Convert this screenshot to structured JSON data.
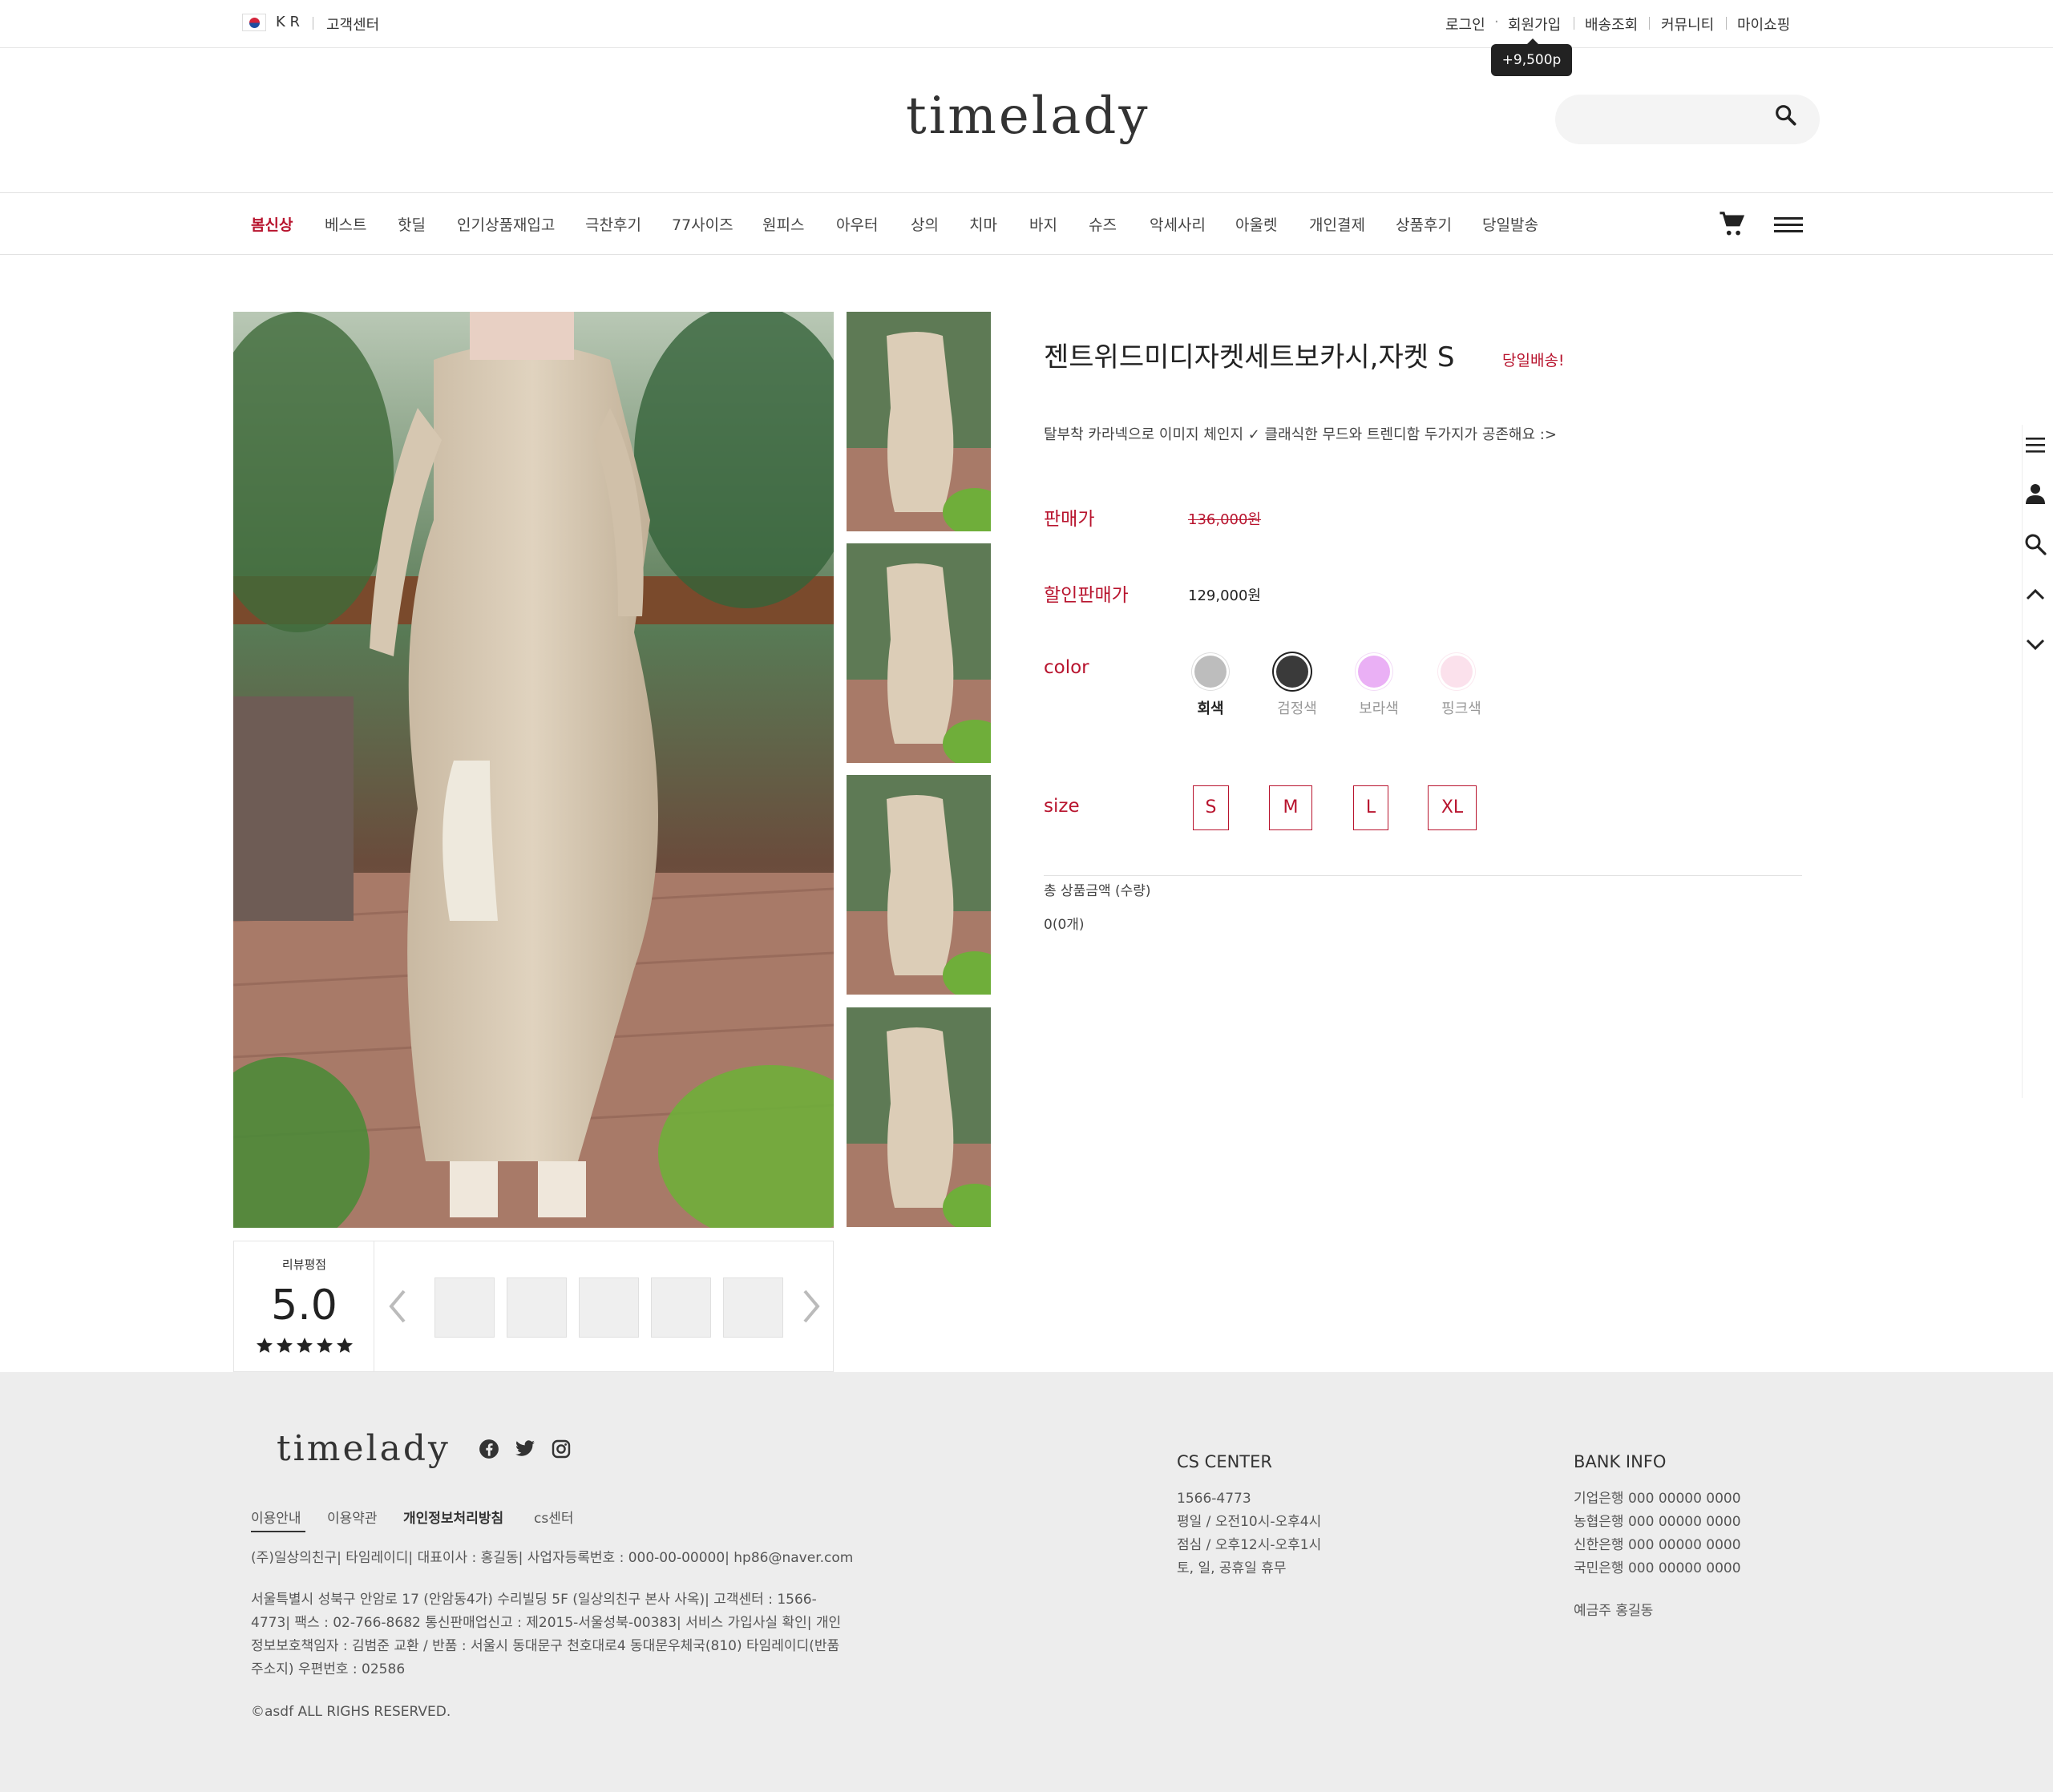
{
  "topbar": {
    "lang": "K R",
    "cs_link": "고객센터",
    "login": "로그인",
    "join": "회원가입",
    "join_point_tooltip": "+9,500p",
    "delivery": "배송조회",
    "community": "커뮤니티",
    "myshop": "마이쇼핑"
  },
  "header": {
    "logo": "timelady",
    "search_placeholder": ""
  },
  "nav": {
    "items": [
      {
        "label": "봄신상",
        "active": true
      },
      {
        "label": "베스트"
      },
      {
        "label": "핫딜"
      },
      {
        "label": "인기상품재입고"
      },
      {
        "label": "극찬후기"
      },
      {
        "label": "77사이즈"
      },
      {
        "label": "원피스"
      },
      {
        "label": "아우터"
      },
      {
        "label": "상의"
      },
      {
        "label": "치마"
      },
      {
        "label": "바지"
      },
      {
        "label": "슈즈"
      },
      {
        "label": "악세사리"
      },
      {
        "label": "아울렛"
      },
      {
        "label": "개인결제"
      },
      {
        "label": "상품후기"
      },
      {
        "label": "당일발송"
      }
    ]
  },
  "product": {
    "title": "젠트위드미디자켓세트보카시,자켓 S",
    "badge": "당일배송!",
    "description": "탈부착 카라넥으로 이미지 체인지 ✓ 클래식한 무드와 트렌디함 두가지가 공존해요 :>",
    "price_label": "판매가",
    "price": "136,000원",
    "sale_label": "할인판매가",
    "sale_price": "129,000원",
    "color_label": "color",
    "colors": [
      {
        "name": "회색",
        "hex": "#bdbdbd",
        "selected": false
      },
      {
        "name": "검정색",
        "hex": "#3a3a3a",
        "selected": true
      },
      {
        "name": "보라색",
        "hex": "#eab0f5",
        "selected": false
      },
      {
        "name": "핑크색",
        "hex": "#fbe1ec",
        "selected": false
      }
    ],
    "size_label": "size",
    "sizes": [
      "S",
      "M",
      "L",
      "XL"
    ],
    "total_label": "총 상품금액 (수량)",
    "total_value": "0(0개)"
  },
  "review": {
    "label": "리뷰평점",
    "score": "5.0",
    "stars": 5
  },
  "footer": {
    "logo": "timelady",
    "social_icons": [
      "facebook-icon",
      "twitter-icon",
      "instagram-icon"
    ],
    "tabs": [
      "이용안내",
      "이용약관",
      "개인정보처리방침",
      "cs센터"
    ],
    "company_line": "(주)일상의친구| 타임레이디| 대표이사 : 홍길동| 사업자등록번호 : 000-00-00000| hp86@naver.com",
    "address_lines": [
      "서울특별시 성북구 안암로 17 (안암동4가) 수리빌딩 5F (일상의친구 본사 사옥)| 고객센터 : 1566-",
      "4773| 팩스 : 02-766-8682 통신판매업신고 : 제2015-서울성북-00383| 서비스 가입사실 확인| 개인",
      "정보보호책임자 : 김범준 교환 / 반품 : 서울시 동대문구 천호대로4 동대문우체국(810) 타임레이디(반품",
      "주소지) 우편번호 : 02586"
    ],
    "copyright": "©asdf ALL RIGHS RESERVED.",
    "cs_title": "CS CENTER",
    "cs_lines": [
      "1566-4773",
      "평일 / 오전10시-오후4시",
      "점심 / 오후12시-오후1시",
      "토, 일, 공휴일 휴무"
    ],
    "bank_title": "BANK INFO",
    "bank_lines": [
      "기업은행 000 00000 0000",
      "농협은행 000 00000 0000",
      "신한은행 000 00000 0000",
      "국민은행 000 00000 0000"
    ],
    "bank_holder": "예금주 홍길동"
  },
  "colors": {
    "accent": "#b8142e",
    "footer_bg": "#ededed"
  }
}
